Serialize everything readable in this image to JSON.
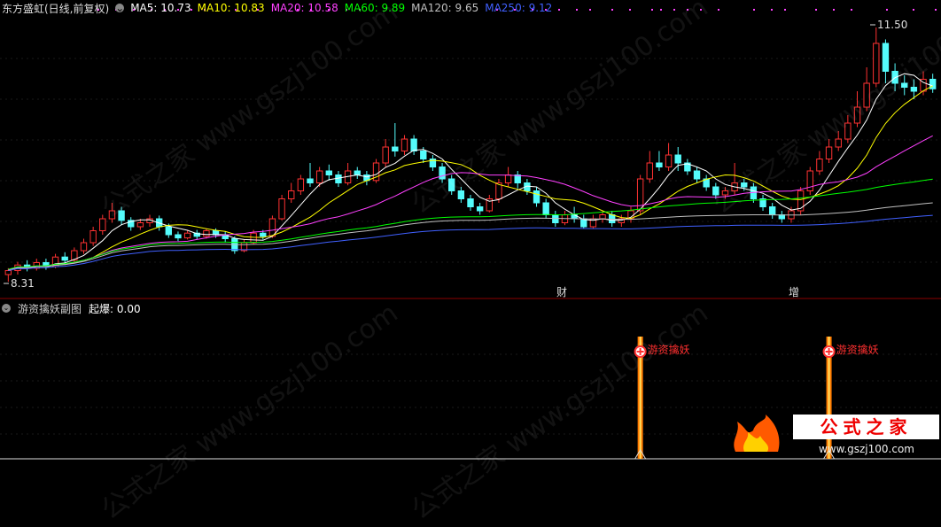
{
  "header": {
    "title": "东方盛虹(日线,前复权)",
    "ma": [
      {
        "label": "MA5:",
        "value": "10.73",
        "color": "#ffffff"
      },
      {
        "label": "MA10:",
        "value": "10.83",
        "color": "#ffff00"
      },
      {
        "label": "MA20:",
        "value": "10.58",
        "color": "#ff40ff"
      },
      {
        "label": "MA60:",
        "value": "9.89",
        "color": "#00ff00"
      },
      {
        "label": "MA120:",
        "value": "9.65",
        "color": "#c0c0c0"
      },
      {
        "label": "MA250:",
        "value": "9.12",
        "color": "#4060ff"
      }
    ]
  },
  "price_labels": {
    "high": "11.50",
    "low": "8.31"
  },
  "event_labels": {
    "cai": "财",
    "zeng": "增"
  },
  "sub_panel": {
    "title": "游资擒妖副图",
    "indicator_label": "起爆:",
    "indicator_value": "0.00",
    "signal_label": "游资擒妖"
  },
  "logo": {
    "name": "公式之家",
    "url": "www.gszj100.com"
  },
  "watermark": "公式之家 www.gszj100.com",
  "colors": {
    "up": "#ff3232",
    "down": "#54fcfc",
    "bg": "#000000"
  },
  "chart_data": {
    "type": "candlestick",
    "series": [
      {
        "name": "MA5",
        "color": "#ffffff"
      },
      {
        "name": "MA10",
        "color": "#ffff00"
      },
      {
        "name": "MA20",
        "color": "#ff40ff"
      },
      {
        "name": "MA60",
        "color": "#00ff00"
      },
      {
        "name": "MA120",
        "color": "#c0c0c0"
      },
      {
        "name": "MA250",
        "color": "#4060ff"
      }
    ],
    "high": 11.5,
    "low": 8.31,
    "ylim": [
      8.2,
      11.6
    ],
    "candles": [
      [
        8.4,
        8.45,
        8.31,
        8.48
      ],
      [
        8.45,
        8.52,
        8.4,
        8.56
      ],
      [
        8.52,
        8.48,
        8.44,
        8.58
      ],
      [
        8.48,
        8.55,
        8.45,
        8.6
      ],
      [
        8.55,
        8.5,
        8.46,
        8.6
      ],
      [
        8.5,
        8.62,
        8.48,
        8.66
      ],
      [
        8.62,
        8.58,
        8.52,
        8.68
      ],
      [
        8.58,
        8.7,
        8.55,
        8.74
      ],
      [
        8.7,
        8.8,
        8.66,
        8.85
      ],
      [
        8.8,
        8.95,
        8.76,
        9.0
      ],
      [
        8.95,
        9.1,
        8.9,
        9.15
      ],
      [
        9.1,
        9.2,
        9.05,
        9.3
      ],
      [
        9.2,
        9.08,
        9.02,
        9.25
      ],
      [
        9.08,
        9.0,
        8.95,
        9.12
      ],
      [
        9.0,
        9.05,
        8.96,
        9.1
      ],
      [
        9.05,
        9.1,
        9.0,
        9.15
      ],
      [
        9.1,
        9.0,
        8.95,
        9.14
      ],
      [
        9.0,
        8.9,
        8.86,
        9.04
      ],
      [
        8.9,
        8.86,
        8.82,
        8.94
      ],
      [
        8.86,
        8.92,
        8.84,
        8.96
      ],
      [
        8.92,
        8.88,
        8.84,
        8.96
      ],
      [
        8.88,
        8.95,
        8.85,
        8.98
      ],
      [
        8.95,
        8.9,
        8.86,
        8.98
      ],
      [
        8.9,
        8.85,
        8.8,
        8.94
      ],
      [
        8.85,
        8.7,
        8.66,
        8.88
      ],
      [
        8.7,
        8.8,
        8.68,
        8.84
      ],
      [
        8.8,
        8.92,
        8.78,
        8.96
      ],
      [
        8.92,
        8.88,
        8.84,
        8.96
      ],
      [
        8.88,
        9.1,
        8.86,
        9.14
      ],
      [
        9.1,
        9.35,
        9.08,
        9.4
      ],
      [
        9.35,
        9.45,
        9.3,
        9.55
      ],
      [
        9.45,
        9.6,
        9.4,
        9.65
      ],
      [
        9.6,
        9.55,
        9.5,
        9.8
      ],
      [
        9.55,
        9.7,
        9.5,
        9.75
      ],
      [
        9.7,
        9.65,
        9.58,
        9.78
      ],
      [
        9.65,
        9.55,
        9.5,
        9.7
      ],
      [
        9.55,
        9.7,
        9.52,
        9.8
      ],
      [
        9.7,
        9.65,
        9.6,
        9.75
      ],
      [
        9.65,
        9.58,
        9.52,
        9.7
      ],
      [
        9.58,
        9.8,
        9.55,
        9.85
      ],
      [
        9.8,
        10.0,
        9.75,
        10.1
      ],
      [
        10.0,
        9.95,
        9.88,
        10.3
      ],
      [
        9.95,
        10.1,
        9.9,
        10.15
      ],
      [
        10.1,
        9.95,
        9.9,
        10.15
      ],
      [
        9.95,
        9.85,
        9.8,
        10.0
      ],
      [
        9.85,
        9.75,
        9.7,
        9.9
      ],
      [
        9.75,
        9.6,
        9.55,
        9.8
      ],
      [
        9.6,
        9.45,
        9.4,
        9.65
      ],
      [
        9.45,
        9.35,
        9.3,
        9.5
      ],
      [
        9.35,
        9.25,
        9.2,
        9.4
      ],
      [
        9.25,
        9.2,
        9.15,
        9.3
      ],
      [
        9.2,
        9.35,
        9.18,
        9.4
      ],
      [
        9.35,
        9.55,
        9.3,
        9.6
      ],
      [
        9.55,
        9.65,
        9.5,
        9.75
      ],
      [
        9.65,
        9.55,
        9.48,
        9.7
      ],
      [
        9.55,
        9.45,
        9.4,
        9.6
      ],
      [
        9.45,
        9.3,
        9.25,
        9.5
      ],
      [
        9.3,
        9.15,
        9.1,
        9.35
      ],
      [
        9.15,
        9.05,
        9.0,
        9.2
      ],
      [
        9.05,
        9.15,
        9.02,
        9.2
      ],
      [
        9.15,
        9.1,
        9.05,
        9.25
      ],
      [
        9.1,
        9.0,
        8.98,
        9.15
      ],
      [
        9.0,
        9.1,
        8.98,
        9.15
      ],
      [
        9.1,
        9.15,
        9.05,
        9.2
      ],
      [
        9.15,
        9.05,
        9.0,
        9.2
      ],
      [
        9.05,
        9.1,
        9.0,
        9.15
      ],
      [
        9.1,
        9.2,
        9.05,
        9.25
      ],
      [
        9.2,
        9.6,
        9.15,
        9.65
      ],
      [
        9.6,
        9.8,
        9.55,
        9.95
      ],
      [
        9.8,
        9.75,
        9.7,
        9.95
      ],
      [
        9.75,
        9.9,
        9.7,
        10.05
      ],
      [
        9.9,
        9.8,
        9.7,
        10.0
      ],
      [
        9.8,
        9.7,
        9.65,
        9.85
      ],
      [
        9.7,
        9.6,
        9.55,
        9.75
      ],
      [
        9.6,
        9.5,
        9.45,
        9.65
      ],
      [
        9.5,
        9.4,
        9.35,
        9.55
      ],
      [
        9.4,
        9.45,
        9.35,
        9.5
      ],
      [
        9.45,
        9.55,
        9.4,
        9.8
      ],
      [
        9.55,
        9.5,
        9.45,
        9.6
      ],
      [
        9.5,
        9.35,
        9.3,
        9.55
      ],
      [
        9.35,
        9.25,
        9.2,
        9.4
      ],
      [
        9.25,
        9.15,
        9.1,
        9.3
      ],
      [
        9.15,
        9.1,
        9.05,
        9.2
      ],
      [
        9.1,
        9.2,
        9.05,
        9.25
      ],
      [
        9.2,
        9.45,
        9.15,
        9.5
      ],
      [
        9.45,
        9.7,
        9.4,
        9.75
      ],
      [
        9.7,
        9.85,
        9.65,
        9.95
      ],
      [
        9.85,
        10.0,
        9.8,
        10.1
      ],
      [
        10.0,
        10.1,
        9.95,
        10.2
      ],
      [
        10.1,
        10.3,
        10.05,
        10.4
      ],
      [
        10.3,
        10.5,
        10.25,
        10.7
      ],
      [
        10.5,
        10.8,
        10.45,
        11.0
      ],
      [
        10.8,
        11.3,
        10.75,
        11.5
      ],
      [
        11.3,
        10.95,
        10.8,
        11.35
      ],
      [
        10.95,
        10.8,
        10.7,
        11.05
      ],
      [
        10.8,
        10.75,
        10.65,
        10.9
      ],
      [
        10.75,
        10.7,
        10.6,
        10.85
      ],
      [
        10.7,
        10.85,
        10.65,
        10.95
      ],
      [
        10.85,
        10.73,
        10.68,
        10.92
      ]
    ],
    "signal_bars": [
      67,
      87
    ],
    "sub_indicator": {
      "name": "起爆",
      "value": 0.0
    }
  }
}
